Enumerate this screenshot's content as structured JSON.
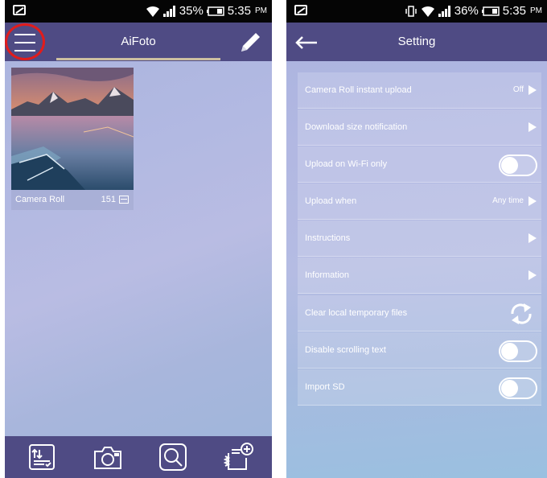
{
  "left": {
    "status": {
      "battery": "35%",
      "time": "5:35",
      "ampm": "PM"
    },
    "title": "AiFoto",
    "icons": {
      "menu": "hamburger-menu-icon",
      "edit": "pencil-icon"
    },
    "album": {
      "name": "Camera Roll",
      "count": "151"
    },
    "bottom_nav": [
      "upload-sort-icon",
      "camera-icon",
      "search-icon",
      "add-files-icon"
    ]
  },
  "right": {
    "status": {
      "battery": "36%",
      "time": "5:35",
      "ampm": "PM"
    },
    "title": "Setting",
    "rows": [
      {
        "label": "Camera Roll instant upload",
        "value": "Off",
        "control": "chevron"
      },
      {
        "label": "Download size notification",
        "value": "",
        "control": "chevron"
      },
      {
        "label": "Upload on Wi-Fi only",
        "value": "",
        "control": "toggle",
        "on": false
      },
      {
        "label": "Upload when",
        "value": "Any time",
        "control": "chevron"
      },
      {
        "label": "Instructions",
        "value": "",
        "control": "chevron"
      },
      {
        "label": "Information",
        "value": "",
        "control": "chevron"
      },
      {
        "label": "Clear local temporary files",
        "value": "",
        "control": "sync"
      },
      {
        "label": "Disable scrolling text",
        "value": "",
        "control": "toggle",
        "on": false
      },
      {
        "label": "Import SD",
        "value": "",
        "control": "toggle",
        "on": false
      }
    ]
  },
  "colors": {
    "appbar": "#4f4b84",
    "status_bar": "#050505",
    "highlight_ring": "#e11c1c",
    "tab_underline": "#cdbfa1"
  }
}
